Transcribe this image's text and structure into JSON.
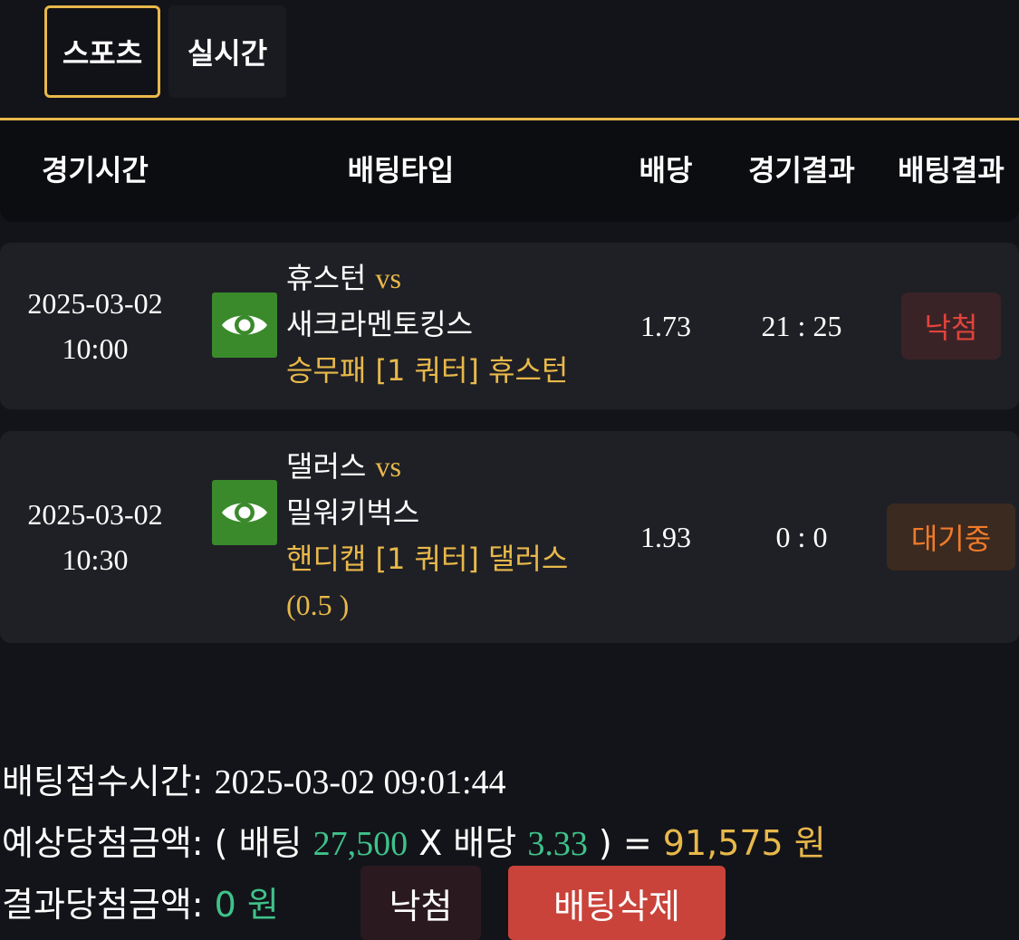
{
  "tabs": [
    {
      "label": "스포츠",
      "active": true
    },
    {
      "label": "실시간",
      "active": false
    }
  ],
  "table": {
    "headers": [
      "경기시간",
      "배팅타입",
      "배당",
      "경기결과",
      "배팅결과"
    ],
    "rows": [
      {
        "date": "2025-03-02",
        "time": "10:00",
        "home": "휴스턴",
        "vs": "vs",
        "away": "새크라멘토킹스",
        "bet_type": "승무패 [1 쿼터] 휴스턴",
        "bet_extra": "",
        "odds": "1.73",
        "score": "21 : 25",
        "result": "낙첨",
        "result_status": "lose"
      },
      {
        "date": "2025-03-02",
        "time": "10:30",
        "home": "댈러스",
        "vs": "vs",
        "away": "밀워키벅스",
        "bet_type": "핸디캡 [1 쿼터] 댈러스",
        "bet_extra": "(0.5 )",
        "odds": "1.93",
        "score": "0 : 0",
        "result": "대기중",
        "result_status": "waiting"
      }
    ]
  },
  "summary": {
    "bet_time_label": "배팅접수시간:",
    "bet_time_value": "2025-03-02 09:01:44",
    "expected_label": "예상당첨금액:",
    "expected_open": "( 배팅",
    "bet_amount": "27,500",
    "times_odds": "X 배당",
    "total_odds": "3.33",
    "expected_close": ") =",
    "expected_amount": "91,575 원",
    "result_label": "결과당첨금액:",
    "result_amount": "0 원"
  },
  "buttons": {
    "result_label": "낙첨",
    "delete_label": "배팅삭제"
  },
  "colors": {
    "accent_gold": "#e8b84a",
    "eye_green": "#3a8a2c",
    "lose_red": "#e0443b",
    "wait_orange": "#f07a2b",
    "value_green": "#3fc28a",
    "delete_red": "#c9433a"
  },
  "icons": {
    "view": "eye-icon"
  }
}
